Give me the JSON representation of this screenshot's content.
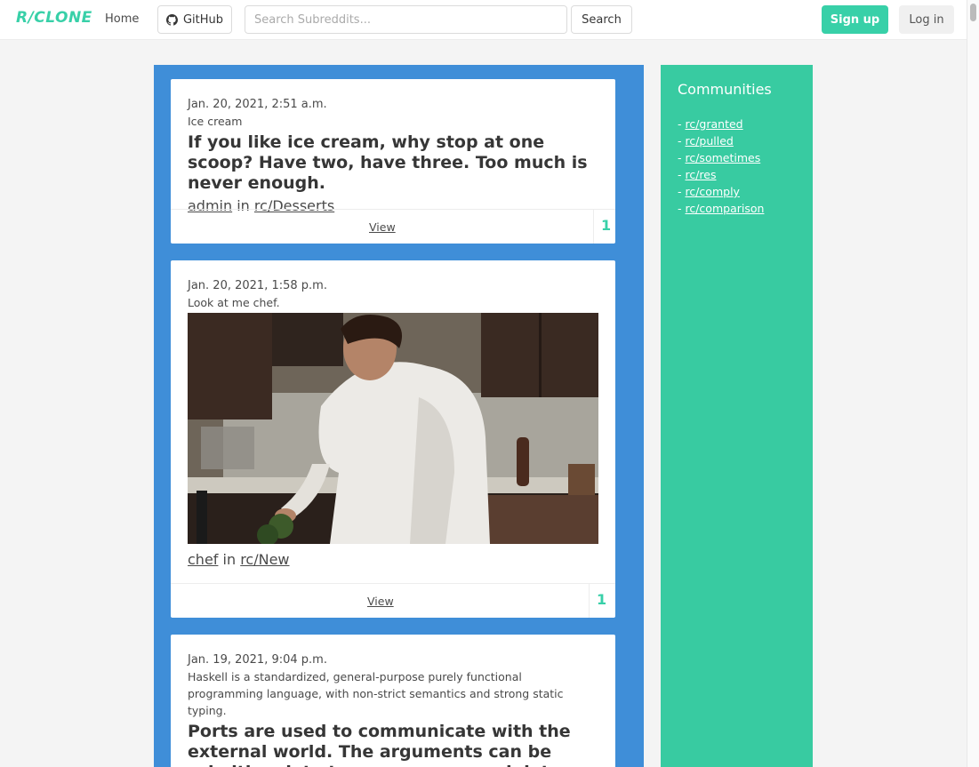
{
  "nav": {
    "logo": "R/CLONE",
    "home": "Home",
    "github": "GitHub",
    "search_placeholder": "Search Subreddits...",
    "search_button": "Search",
    "signup": "Sign up",
    "login": "Log in"
  },
  "posts": [
    {
      "date": "Jan. 20, 2021, 2:51 a.m.",
      "subtitle": "Ice cream",
      "title": "If you like ice cream, why stop at one scoop? Have two, have three. Too much is never enough.",
      "author": "admin",
      "in_word": "in",
      "community": "rc/Desserts",
      "view": "View",
      "votes": "1"
    },
    {
      "date": "Jan. 20, 2021, 1:58 p.m.",
      "subtitle": "Look at me chef.",
      "author": "chef",
      "in_word": "in",
      "community": "rc/New",
      "view": "View",
      "votes": "1"
    },
    {
      "date": "Jan. 19, 2021, 9:04 p.m.",
      "subtitle": "Haskell is a standardized, general-purpose purely functional programming language, with non-strict semantics and strong static typing.",
      "title": "Ports are used to communicate with the external world. The arguments can be primitive data types or compound data types. Do you have any idea"
    }
  ],
  "sidebar": {
    "title": "Communities",
    "items": [
      {
        "prefix": "- ",
        "label": "rc/granted"
      },
      {
        "prefix": "- ",
        "label": "rc/pulled"
      },
      {
        "prefix": "- ",
        "label": "rc/sometimes"
      },
      {
        "prefix": "- ",
        "label": "rc/res"
      },
      {
        "prefix": "- ",
        "label": "rc/comply"
      },
      {
        "prefix": "- ",
        "label": "rc/comparison"
      }
    ]
  },
  "colors": {
    "accent": "#38d0a8",
    "feed_bg": "#3f8ed8",
    "sidebar_bg": "#38cba1"
  }
}
